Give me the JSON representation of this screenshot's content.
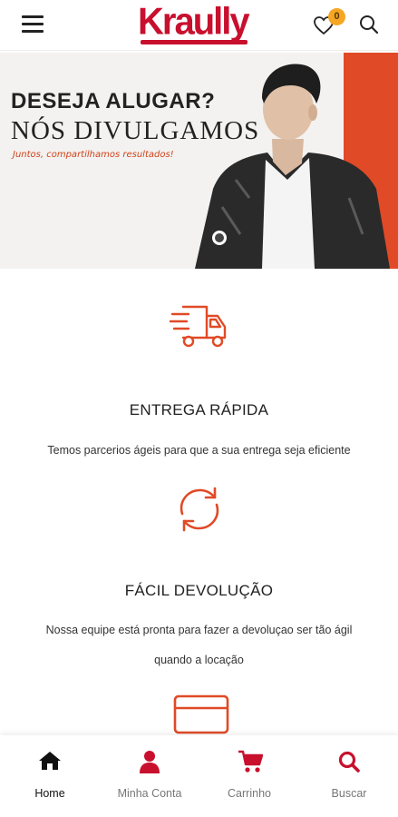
{
  "header": {
    "logo_text": "Kraully",
    "wishlist_count": "0",
    "icons": [
      "menu-icon",
      "heart-icon",
      "search-icon"
    ]
  },
  "banner": {
    "title_line1": "DESEJA ALUGAR?",
    "title_line2": "NÓS DIVULGAMOS",
    "subtitle": "Juntos, compartilhamos resultados!",
    "accent_color": "#e04a26"
  },
  "features": [
    {
      "icon": "delivery-truck-icon",
      "title": "ENTREGA RÁPIDA",
      "text": "Temos parcerios ágeis para que a sua entrega seja eficiente"
    },
    {
      "icon": "refresh-icon",
      "title": "FÁCIL DEVOLUÇÃO",
      "text_line1": "Nossa equipe está pronta para fazer a devoluçao ser tão ágil",
      "text_line2": "quando a locação"
    },
    {
      "icon": "credit-card-icon"
    }
  ],
  "bottom_nav": [
    {
      "label": "Home",
      "icon": "home-icon",
      "active": true
    },
    {
      "label": "Minha Conta",
      "icon": "user-icon"
    },
    {
      "label": "Carrinho",
      "icon": "cart-icon"
    },
    {
      "label": "Buscar",
      "icon": "search-icon"
    }
  ],
  "colors": {
    "brand": "#c8102e",
    "accent": "#e04a26",
    "badge": "#f5a623"
  }
}
